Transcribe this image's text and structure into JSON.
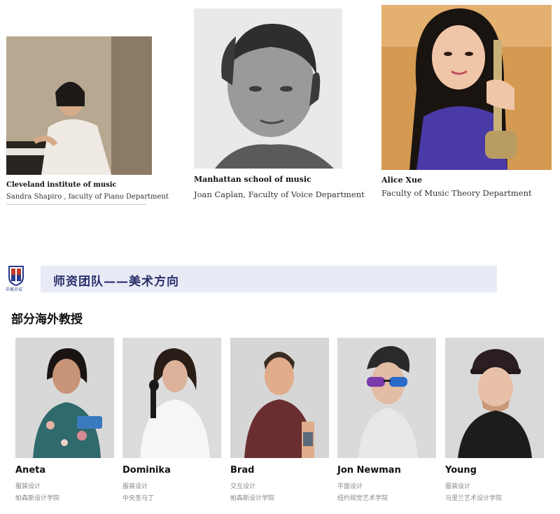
{
  "music_faculty": [
    {
      "school": "Cleveland institute of music",
      "description": "Sandra Shapiro , faculty of Piano Department"
    },
    {
      "school": "Manhattan school of music",
      "description": "Joan Caplan, Faculty of Voice Department"
    },
    {
      "school": "Alice Xue",
      "description": "Faculty of Music Theory Department"
    }
  ],
  "section": {
    "logo_caption": "中美贝拉",
    "title": "师资团队——美术方向"
  },
  "subsection_title": "部分海外教授",
  "art_faculty": [
    {
      "name": "Aneta",
      "role": "服装设计",
      "school": "帕森斯设计学院"
    },
    {
      "name": "Dominika",
      "role": "服装设计",
      "school": "中央圣马丁"
    },
    {
      "name": "Brad",
      "role": "交互设计",
      "school": "帕森斯设计学院"
    },
    {
      "name": "Jon Newman",
      "role": "平面设计",
      "school": "纽约视觉艺术学院"
    },
    {
      "name": "Young",
      "role": "服装设计",
      "school": "马里兰艺术设计学院"
    }
  ],
  "colors": {
    "section_bar": "#e8ebf6",
    "section_title": "#2a2f6b",
    "muted_text": "#888888"
  }
}
